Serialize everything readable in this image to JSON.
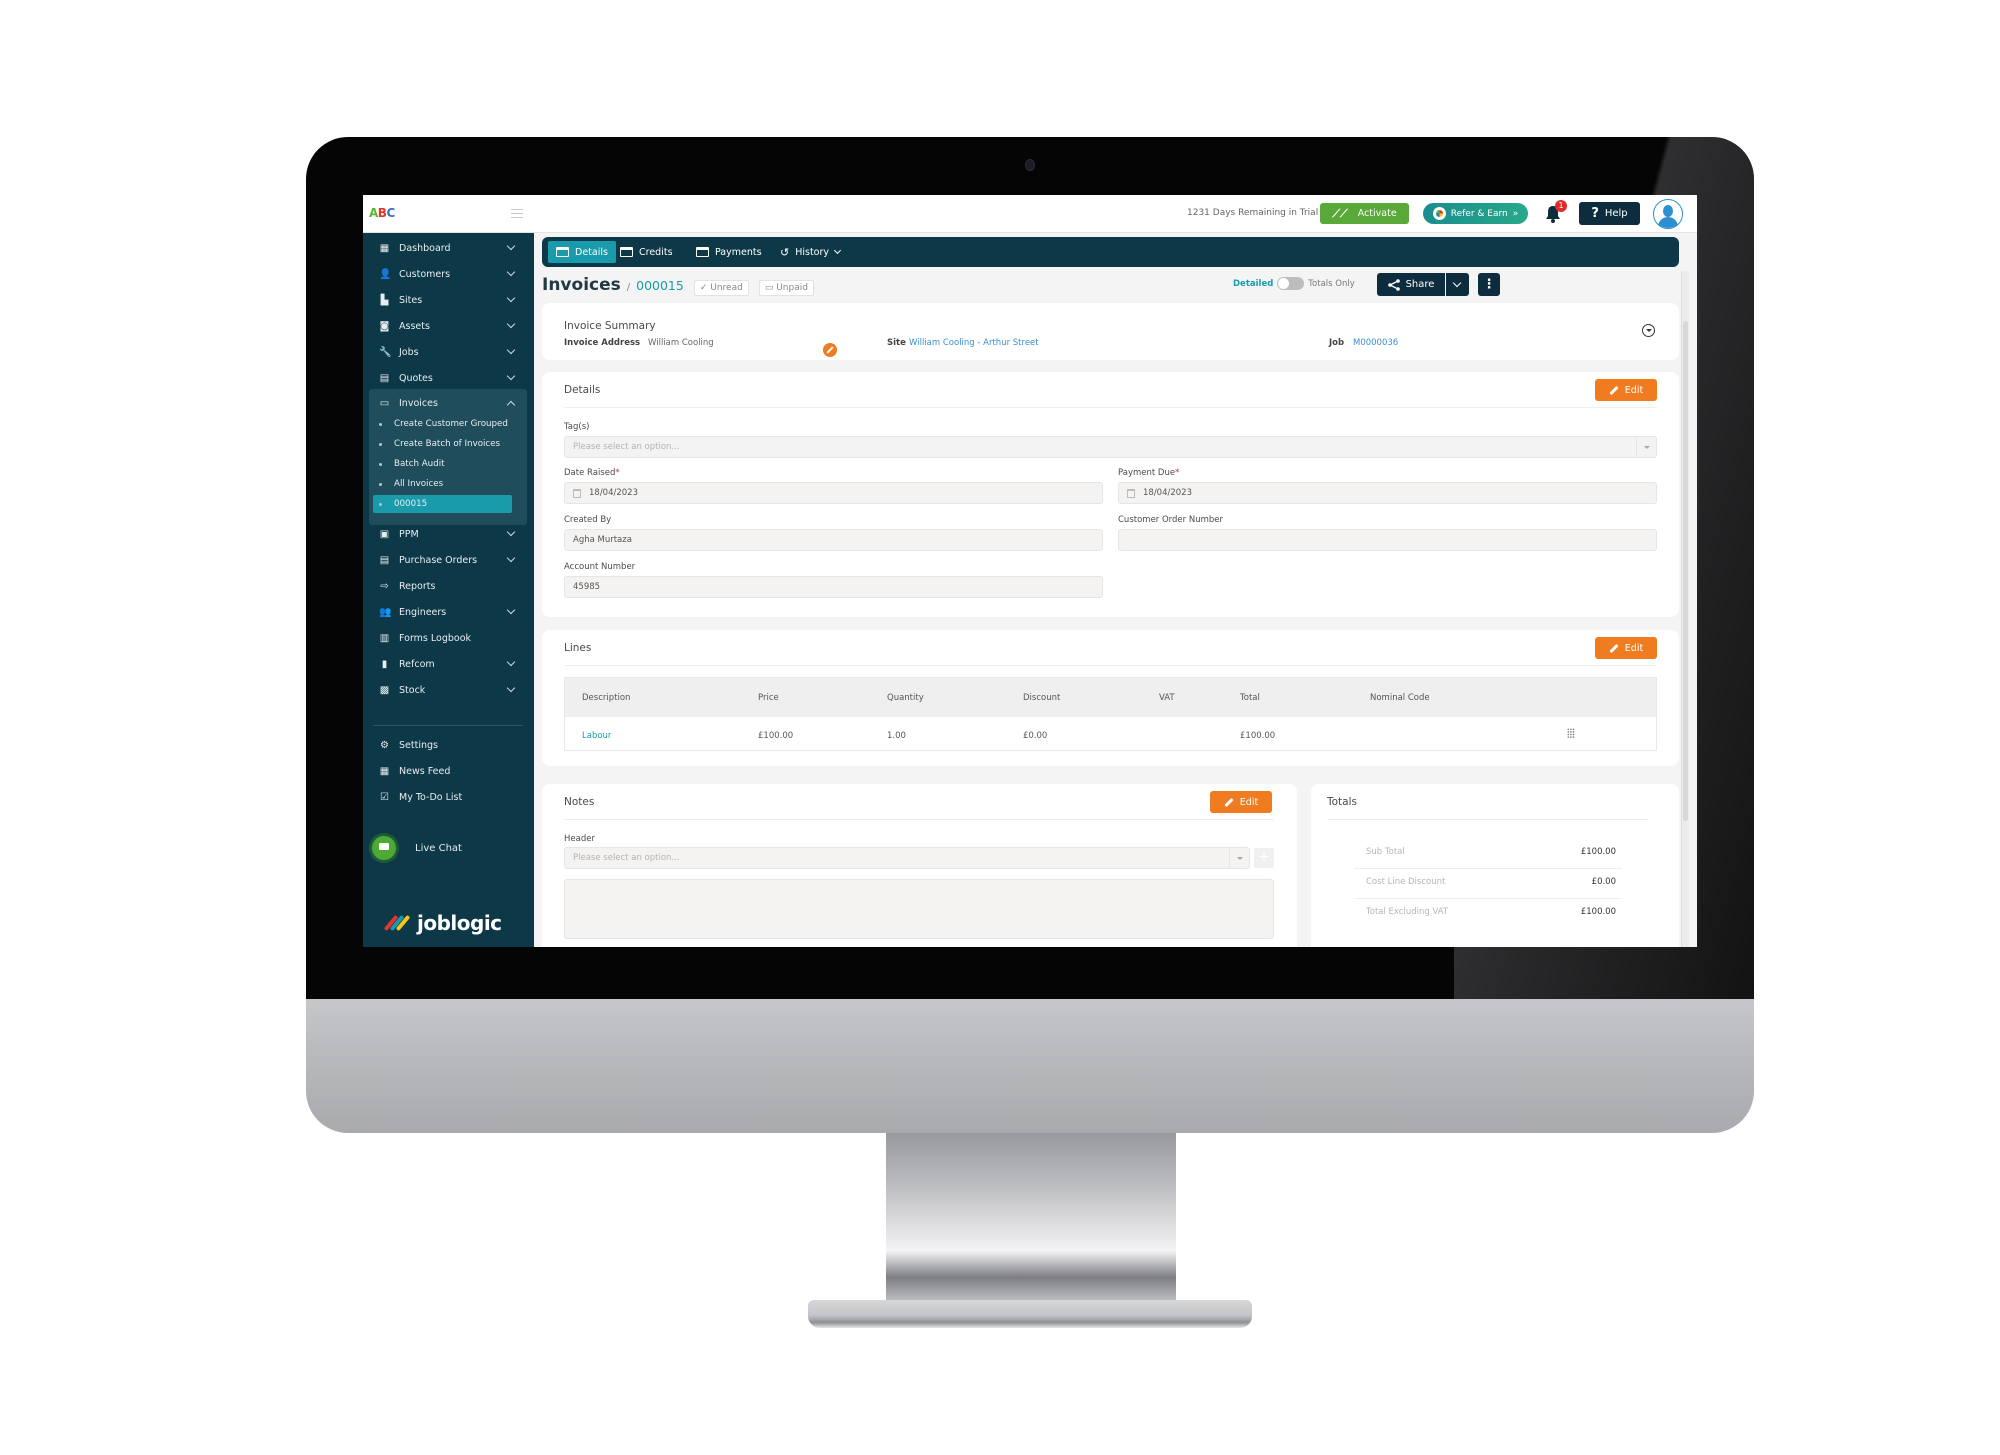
{
  "topbar": {
    "logo": {
      "a": "A",
      "b": "B",
      "c": "C"
    },
    "trial_text": "1231 Days Remaining in Trial",
    "activate_label": "Activate",
    "refer_label": "Refer & Earn",
    "refer_chevrons": "»",
    "notification_count": "1",
    "help_icon": "?",
    "help_label": "Help"
  },
  "sidebar": {
    "items": [
      {
        "label": "Dashboard",
        "icon": "dashboard-icon",
        "glyph": "▦",
        "expandable": true
      },
      {
        "label": "Customers",
        "icon": "user-icon",
        "glyph": "👤",
        "expandable": true
      },
      {
        "label": "Sites",
        "icon": "building-icon",
        "glyph": "▙",
        "expandable": true
      },
      {
        "label": "Assets",
        "icon": "asset-icon",
        "glyph": "◙",
        "expandable": true
      },
      {
        "label": "Jobs",
        "icon": "wrench-icon",
        "glyph": "🔧",
        "expandable": true
      },
      {
        "label": "Quotes",
        "icon": "clipboard-icon",
        "glyph": "▤",
        "expandable": true
      },
      {
        "label": "Invoices",
        "icon": "invoice-icon",
        "glyph": "▭",
        "expandable": true,
        "expanded": true
      },
      {
        "label": "PPM",
        "icon": "ppm-icon",
        "glyph": "▣",
        "expandable": true
      },
      {
        "label": "Purchase Orders",
        "icon": "document-icon",
        "glyph": "▤",
        "expandable": true
      },
      {
        "label": "Reports",
        "icon": "report-export-icon",
        "glyph": "⇨",
        "expandable": false
      },
      {
        "label": "Engineers",
        "icon": "users-icon",
        "glyph": "👥",
        "expandable": true
      },
      {
        "label": "Forms Logbook",
        "icon": "book-icon",
        "glyph": "▥",
        "expandable": false
      },
      {
        "label": "Refcom",
        "icon": "cylinder-icon",
        "glyph": "▮",
        "expandable": true
      },
      {
        "label": "Stock",
        "icon": "warehouse-icon",
        "glyph": "▩",
        "expandable": true
      }
    ],
    "invoice_subitems": [
      {
        "label": "Create Customer Grouped"
      },
      {
        "label": "Create Batch of Invoices"
      },
      {
        "label": "Batch Audit"
      },
      {
        "label": "All Invoices"
      },
      {
        "label": "000015",
        "active": true
      }
    ],
    "bottom_items": [
      {
        "label": "Settings",
        "icon": "user-settings-icon",
        "glyph": "⚙"
      },
      {
        "label": "News Feed",
        "icon": "newspaper-icon",
        "glyph": "▦"
      },
      {
        "label": "My To-Do List",
        "icon": "checklist-icon",
        "glyph": "☑"
      }
    ],
    "live_chat_label": "Live Chat",
    "brand": "joblogic"
  },
  "tabs": [
    {
      "label": "Details",
      "icon": "card-icon",
      "active": true
    },
    {
      "label": "Credits",
      "icon": "credit-off-icon",
      "active": false
    },
    {
      "label": "Payments",
      "icon": "payment-card-icon",
      "active": false
    },
    {
      "label": "History",
      "icon": "history-icon",
      "active": false,
      "dropdown": true
    }
  ],
  "breadcrumb": {
    "title": "Invoices",
    "separator": "/",
    "number": "000015",
    "read_status": "Unread",
    "payment_status": "Unpaid"
  },
  "view_toggle": {
    "left": "Detailed",
    "right": "Totals Only",
    "state": "Detailed"
  },
  "actions": {
    "share_label": "Share",
    "more_icon": "⋮"
  },
  "summary": {
    "title": "Invoice Summary",
    "address_label": "Invoice Address",
    "address_value": "William Cooling",
    "site_label": "Site",
    "site_value": "William Cooling - Arthur Street",
    "job_label": "Job",
    "job_value": "M0000036"
  },
  "details": {
    "title": "Details",
    "edit_label": "Edit",
    "tags_label": "Tag(s)",
    "tags_placeholder": "Please select an option...",
    "date_raised_label": "Date Raised",
    "date_raised_value": "18/04/2023",
    "payment_due_label": "Payment Due",
    "payment_due_value": "18/04/2023",
    "required_mark": "*",
    "created_by_label": "Created By",
    "created_by_value": "Agha Murtaza",
    "customer_order_label": "Customer Order Number",
    "customer_order_value": "",
    "account_number_label": "Account Number",
    "account_number_value": "45985"
  },
  "lines": {
    "title": "Lines",
    "edit_label": "Edit",
    "columns": [
      "Description",
      "Price",
      "Quantity",
      "Discount",
      "VAT",
      "Total",
      "Nominal Code"
    ],
    "rows": [
      {
        "description": "Labour",
        "price": "£100.00",
        "quantity": "1.00",
        "discount": "£0.00",
        "vat": "",
        "total": "£100.00",
        "nominal_code": ""
      }
    ]
  },
  "notes": {
    "title": "Notes",
    "edit_label": "Edit",
    "header_label": "Header",
    "header_placeholder": "Please select an option...",
    "add_icon": "+"
  },
  "totals": {
    "title": "Totals",
    "rows": [
      {
        "label": "Sub Total",
        "value": "£100.00"
      },
      {
        "label": "Cost Line Discount",
        "value": "£0.00"
      },
      {
        "label": "Total Excluding VAT",
        "value": "£100.00"
      }
    ]
  },
  "colors": {
    "sidebar_bg": "#0d3848",
    "accent_teal": "#1a9bab",
    "edit_orange": "#f07c22",
    "activate_green": "#58a83a",
    "dark_navy": "#0d2d3e",
    "link_blue": "#3b8fd0",
    "badge_red": "#e12b2b"
  }
}
